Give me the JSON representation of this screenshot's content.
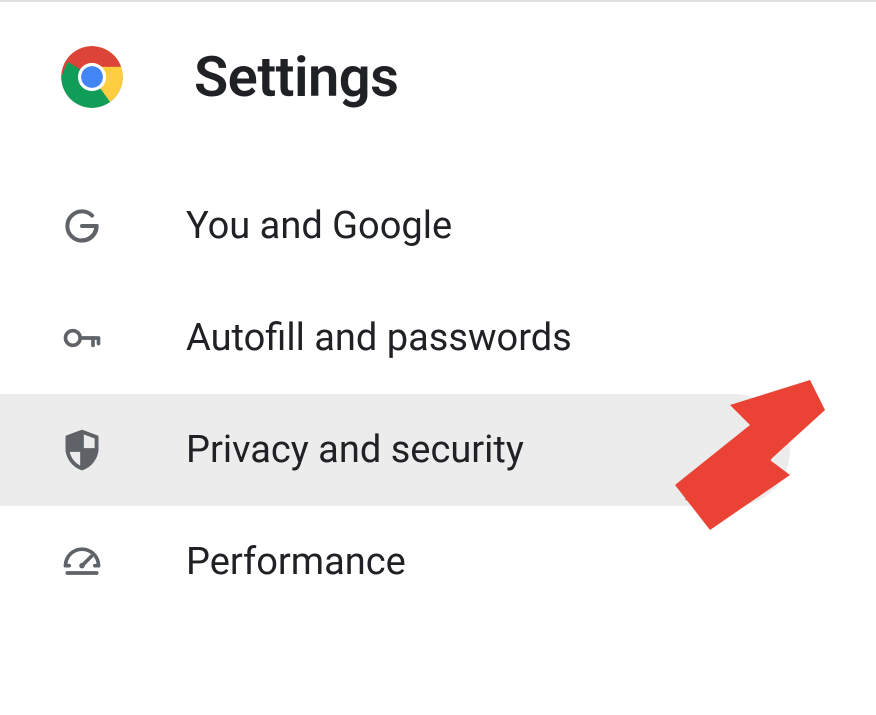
{
  "header": {
    "title": "Settings"
  },
  "nav": {
    "items": [
      {
        "id": "you-and-google",
        "label": "You and Google",
        "icon": "google-g-icon",
        "selected": false
      },
      {
        "id": "autofill-passwords",
        "label": "Autofill and passwords",
        "icon": "key-icon",
        "selected": false
      },
      {
        "id": "privacy-security",
        "label": "Privacy and security",
        "icon": "shield-icon",
        "selected": true
      },
      {
        "id": "performance",
        "label": "Performance",
        "icon": "gauge-icon",
        "selected": false
      }
    ]
  },
  "annotation": {
    "arrow_color": "#EA4335",
    "points_to": "privacy-security"
  }
}
